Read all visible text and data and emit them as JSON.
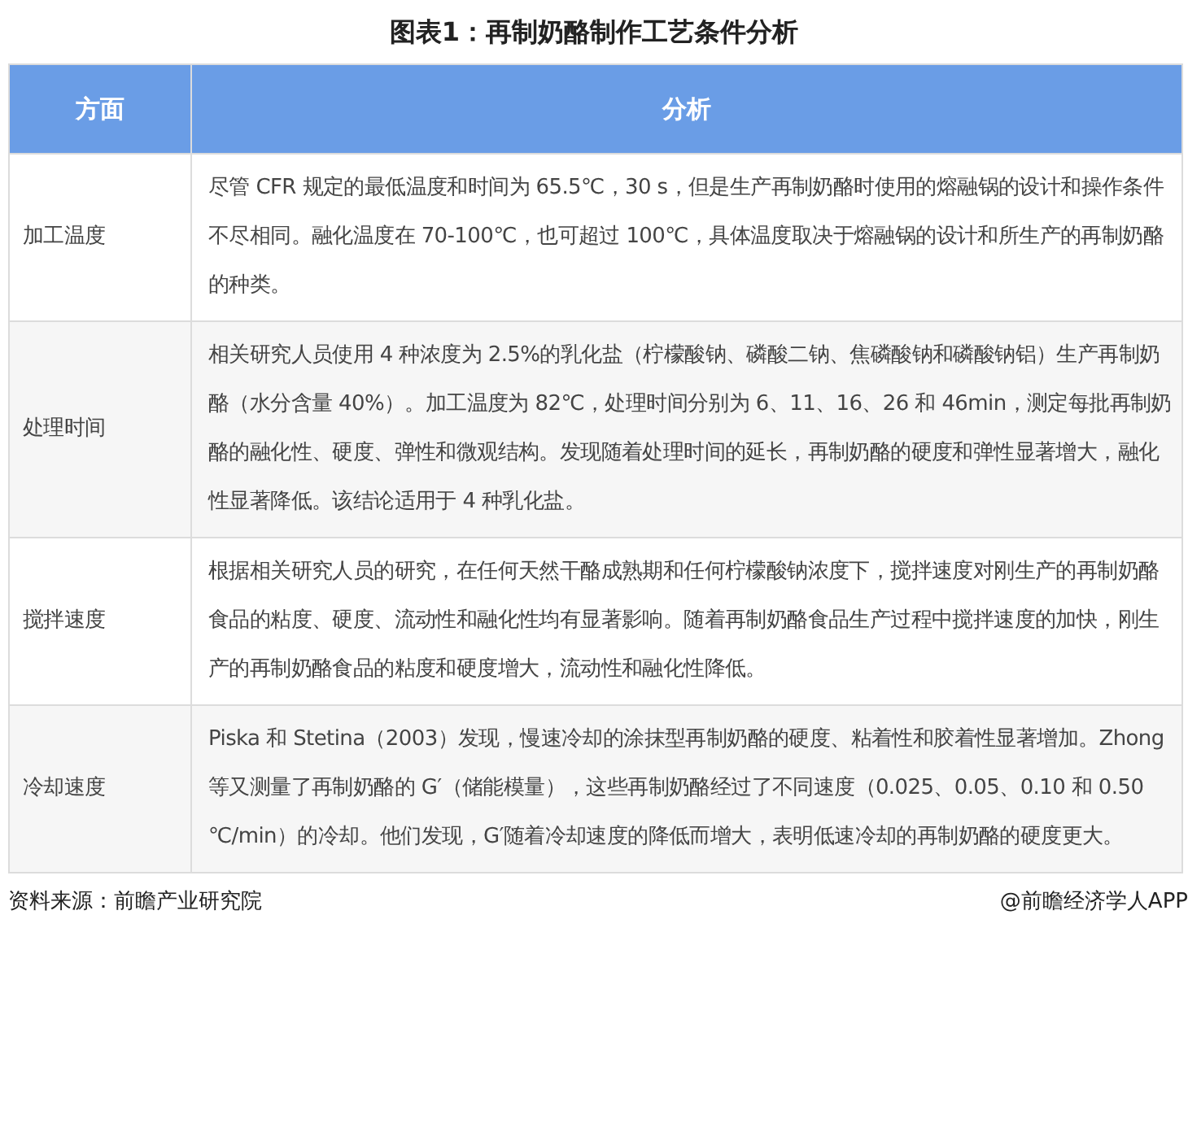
{
  "title": "图表1：再制奶酪制作工艺条件分析",
  "table": {
    "columns": [
      "方面",
      "分析"
    ],
    "rows": [
      {
        "aspect": "加工温度",
        "analysis": "尽管 CFR 规定的最低温度和时间为 65.5℃，30 s，但是生产再制奶酪时使用的熔融锅的设计和操作条件不尽相同。融化温度在 70-100℃，也可超过 100℃，具体温度取决于熔融锅的设计和所生产的再制奶酪的种类。"
      },
      {
        "aspect": "处理时间",
        "analysis": "相关研究人员使用 4 种浓度为 2.5%的乳化盐（柠檬酸钠、磷酸二钠、焦磷酸钠和磷酸钠铝）生产再制奶酪（水分含量 40%）。加工温度为 82℃，处理时间分别为 6、11、16、26 和 46min，测定每批再制奶酪的融化性、硬度、弹性和微观结构。发现随着处理时间的延长，再制奶酪的硬度和弹性显著增大，融化性显著降低。该结论适用于 4 种乳化盐。"
      },
      {
        "aspect": "搅拌速度",
        "analysis": "根据相关研究人员的研究，在任何天然干酪成熟期和任何柠檬酸钠浓度下，搅拌速度对刚生产的再制奶酪食品的粘度、硬度、流动性和融化性均有显著影响。随着再制奶酪食品生产过程中搅拌速度的加快，刚生产的再制奶酪食品的粘度和硬度增大，流动性和融化性降低。"
      },
      {
        "aspect": "冷却速度",
        "analysis": "Piska 和 Stetina（2003）发现，慢速冷却的涂抹型再制奶酪的硬度、粘着性和胶着性显著增加。Zhong 等又测量了再制奶酪的 G′（储能模量），这些再制奶酪经过了不同速度（0.025、0.05、0.10 和 0.50 ℃/min）的冷却。他们发现，G′随着冷却速度的降低而增大，表明低速冷却的再制奶酪的硬度更大。"
      }
    ]
  },
  "footer": {
    "source": "资料来源：前瞻产业研究院",
    "credit": "@前瞻经济学人APP"
  }
}
